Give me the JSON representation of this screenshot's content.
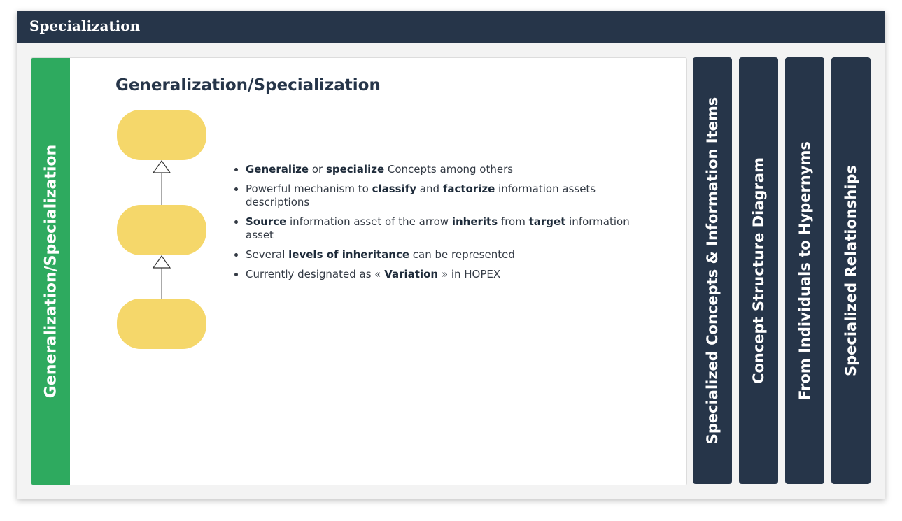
{
  "window": {
    "title": "Specialization"
  },
  "active_tab": {
    "label": "Generalization/Specialization"
  },
  "slide": {
    "title": "Generalization/Specialization",
    "bullets": [
      {
        "parts": [
          {
            "t": "Generalize",
            "b": true
          },
          {
            "t": " or "
          },
          {
            "t": "specialize",
            "b": true
          },
          {
            "t": " Concepts among others"
          }
        ]
      },
      {
        "parts": [
          {
            "t": "Powerful mechanism to "
          },
          {
            "t": "classify",
            "b": true
          },
          {
            "t": " and "
          },
          {
            "t": "factorize",
            "b": true
          },
          {
            "t": " information assets descriptions"
          }
        ]
      },
      {
        "parts": [
          {
            "t": "Source",
            "b": true
          },
          {
            "t": " information asset of the arrow "
          },
          {
            "t": "inherits",
            "b": true
          },
          {
            "t": " from "
          },
          {
            "t": "target",
            "b": true
          },
          {
            "t": " information asset"
          }
        ]
      },
      {
        "parts": [
          {
            "t": "Several "
          },
          {
            "t": "levels of inheritance",
            "b": true
          },
          {
            "t": " can be represented"
          }
        ]
      },
      {
        "parts": [
          {
            "t": "Currently designated as « "
          },
          {
            "t": "Variation",
            "b": true
          },
          {
            "t": " » in HOPEX"
          }
        ]
      }
    ]
  },
  "side_tabs": [
    {
      "label": "Specialized Concepts & Information Items"
    },
    {
      "label": "Concept Structure Diagram"
    },
    {
      "label": "From Individuals to Hypernyms"
    },
    {
      "label": "Specialized Relationships"
    }
  ],
  "colors": {
    "header": "#263549",
    "active_tab": "#2eaa5f",
    "node_fill": "#f5d76a",
    "side_tab": "#263549"
  }
}
